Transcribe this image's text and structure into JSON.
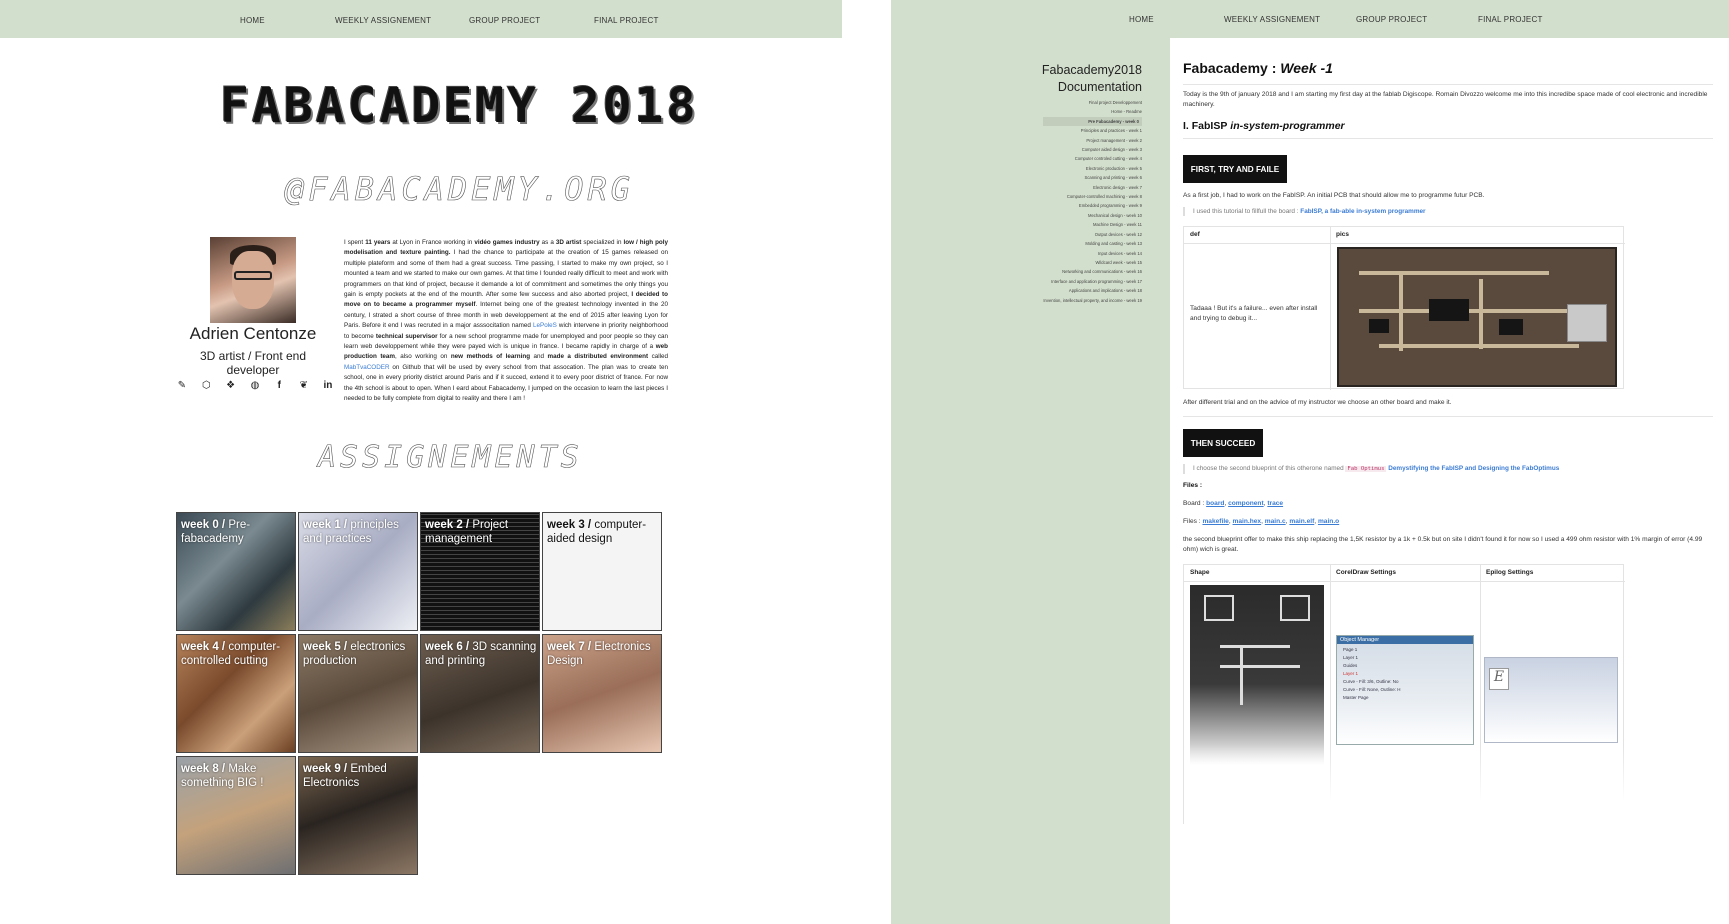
{
  "left": {
    "nav": [
      "HOME",
      "WEEKLY ASSIGNEMENT",
      "GROUP PROJECT",
      "FINAL PROJECT"
    ],
    "ascii_title": "FABACADEMY 2018",
    "ascii_subtitle": "@FABACADEMY.ORG",
    "ascii_section": "ASSIGNEMENTS",
    "profile": {
      "name": "Adrien Centonze",
      "role": "3D artist / Front end developer",
      "socials": [
        "brush-icon",
        "codepen-icon",
        "codepen2-icon",
        "github-icon",
        "facebook-icon",
        "twitter-icon",
        "linkedin-icon"
      ]
    },
    "bio": {
      "p1": "I spent",
      "b1": "11 years",
      "p2": "at Lyon in France working in",
      "b2": "vidéo games industry",
      "p3": "as a",
      "b3": "3D artist",
      "p4": "specialized in",
      "b4": "low / high poly modelisation and texture painting.",
      "p5": "I had the chance to participate at the creation of 15 games released on multiple plateform and some of them had a great success. Time passing, I started to make my own project, so I mounted a team and we started to make our own games. At that time I founded really difficult to meet and work with programmers on that kind of project, because it demande a lot of commitment and sometimes the only things you gain is empty pockets at the end of the mounth. After some few success and also aborted project,",
      "b5": "I decided to move on to became a programmer myself",
      "p6": ". Internet being one of the greatest technology invented in the 20 century, I strated a short course of three month in web developpement at the end of 2015 after leaving Lyon for Paris. Before it end I was recruted in a major asssocitation named",
      "link1": "LePoleS",
      "p7": "wich intervene in priority neighborhood to become",
      "b6": "technical supervisor",
      "p8": "for a new school programme made for unemployed and poor people so they can learn web developpement while they were payed wich is unique in france. I became rapidly in charge of a",
      "b7": "web production team",
      "p9": ", also working on",
      "b8": "new methods of learning",
      "p10": "and",
      "b9": "made a distributed environment",
      "p11": "called",
      "link2": "MabTvaCODER",
      "p12": "on Github that will be used by every school from that assocation. The plan was to create ten school, one in every priority district around Paris and if it succed, extend it to every poor district of france. For now the 4th school is about to open. When I eard about Fabacademy, I jumped on the occasion to learn the last pieces I needed to be fully complete from digital to reality and there I am !"
    },
    "weeks": [
      {
        "num": "week 0 /",
        "title": "Pre-fabacademy"
      },
      {
        "num": "week 1 /",
        "title": "principles and practices"
      },
      {
        "num": "week 2 /",
        "title": "Project management"
      },
      {
        "num": "week 3 /",
        "title": "computer-aided design"
      },
      {
        "num": "week 4 /",
        "title": "computer-controlled cutting"
      },
      {
        "num": "week 5 /",
        "title": "electronics production"
      },
      {
        "num": "week 6 /",
        "title": "3D scanning and printing"
      },
      {
        "num": "week 7 /",
        "title": "Electronics Design"
      },
      {
        "num": "week 8 /",
        "title": "Make something BIG !"
      },
      {
        "num": "week 9 /",
        "title": "Embed Electronics"
      }
    ]
  },
  "right": {
    "nav": [
      "HOME",
      "WEEKLY ASSIGNEMENT",
      "GROUP PROJECT",
      "FINAL PROJECT"
    ],
    "side_title_1": "Fabacademy2018",
    "side_title_2": "Documentation",
    "toc": [
      "Final project Developpement",
      "Home - Readme",
      "Pre Fabacademy - week 0",
      "Principles and practices - week 1",
      "Project management - week 2",
      "Computer aided design - week 3",
      "Computer controled cutting - week 4",
      "Electronic production - week 5",
      "Scanning and printing - week 6",
      "Electronic design - week 7",
      "Computer-controlled machining - week 8",
      "Embedded programming - week 9",
      "Mechanical design - week 10",
      "Machine Design - week 11",
      "Output devices - week 12",
      "Molding and casting - week 13",
      "Input devices - week 14",
      "Wildcard week - week 15",
      "Networking and communications - week 16",
      "Interface and application programming - week 17",
      "Applications and implications - week 18",
      "Invention, intellectual property, and income - week 19"
    ],
    "toc_active_index": 2,
    "heading_main": "Fabacademy :",
    "heading_em": "Week -1",
    "intro": "Today is the 9th of january 2018 and I am starting my first day at the fablab Digiscope. Romain Divozzo welcome me into this incredibe space made of cool electronic and incredible machinery.",
    "section_num": "I.",
    "section_b": "FabISP",
    "section_em": "in-system-programmer",
    "btn1": "FIRST, TRY AND FAILE",
    "p_first_job": "As a first job, I had to work on the FabISP. An initial PCB that should allow me to programme futur PCB.",
    "quote1_text": "I used this tutorial to fillfull the board :",
    "quote1_link": "FabISP, a fab-able in-system programmer",
    "table1": {
      "headers": [
        "def",
        "pics"
      ],
      "def_cell": "Tadaaa ! But it's a failure... even after install and trying to debug it..."
    },
    "p_after": "After different trial and on the advice of my instructor we choose an other board and make it.",
    "btn2": "THEN SUCCEED",
    "quote2_text": "I choose the second blueprint of this otherone named",
    "quote2_code": "Fab Optimus",
    "quote2_link": "Demystifying the FabISP and Designing the FabOptimus",
    "files_label": "Files :",
    "board_label": "Board :",
    "board_links": [
      "board",
      "component",
      "trace"
    ],
    "files2_label": "Files :",
    "files2_links": [
      "makefile",
      "main.hex",
      "main.c",
      "main.elf",
      "main.o"
    ],
    "p_blueprint": "the second blueprint offer to make this ship replacing the 1,5K resistor by a 1k + 0.5k but on site I didn't found it for now so I used a 499 ohm resistor with 1% margin of error (4.99 ohm) wich is great.",
    "table2_headers": [
      "Shape",
      "CorelDraw Settings",
      "Epilog Settings"
    ],
    "object_manager": {
      "title": "Object Manager",
      "rows": [
        "Page 1",
        "Layer 1",
        "Guides",
        "Layer 1",
        "Curve - Fill: 3/6, Outline: No",
        "Curve - Fill: None, Outline: H",
        "Master Page"
      ]
    }
  },
  "colors": {
    "nav_bg": "#d3dfcd",
    "link": "#3b7cd4",
    "button_bg": "#111111"
  }
}
